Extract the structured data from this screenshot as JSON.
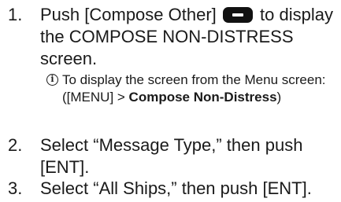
{
  "steps": [
    {
      "number": "1.",
      "text_before_icon": "Push [Compose Other]",
      "icon": "minus-key-icon",
      "text_after_icon": " to display the COMPOSE NON-DISTRESS screen."
    },
    {
      "number": "2.",
      "text": "Select “Message Type,” then push [ENT]."
    },
    {
      "number": "3.",
      "text": "Select “All Ships,” then push [ENT]."
    }
  ],
  "note": {
    "icon": "info-icon",
    "icon_glyph": "i",
    "text": "To display the screen from the Menu screen:",
    "path_prefix": "([MENU] > ",
    "path_bold": "Compose Non-Distress",
    "path_suffix": ")"
  }
}
